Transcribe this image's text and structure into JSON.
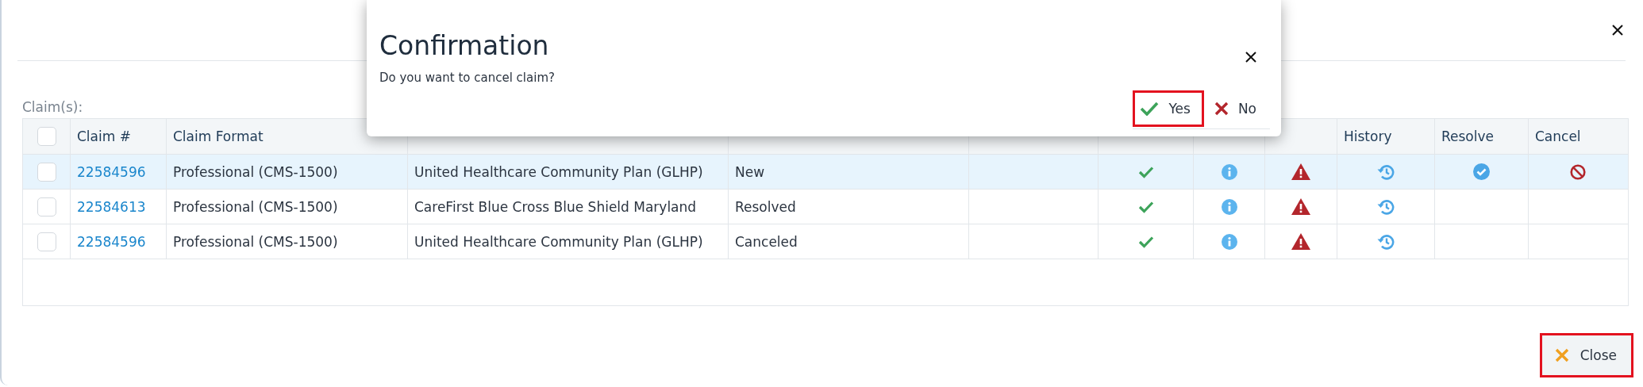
{
  "dialog": {
    "title": "Confirmation",
    "message": "Do you want to cancel claim?",
    "buttons": [
      {
        "label": "Yes",
        "kind": "confirm",
        "focused": true
      },
      {
        "label": "No",
        "kind": "decline",
        "focused": false
      }
    ]
  },
  "section_label": "Claim(s):",
  "table": {
    "select_all": {
      "checked": false
    },
    "columns": [
      {
        "label": "Claim #",
        "kind": "claim"
      },
      {
        "label": "Claim Format",
        "kind": "format"
      },
      {
        "kind": "payer"
      },
      {
        "kind": "status"
      },
      {
        "kind": "sent_date"
      },
      {
        "kind": "sent"
      },
      {
        "kind": "info"
      },
      {
        "kind": "warning"
      },
      {
        "label": "History",
        "kind": "history"
      },
      {
        "label": "Resolve",
        "kind": "resolve"
      },
      {
        "label": "Cancel",
        "kind": "cancel"
      }
    ],
    "rows": [
      {
        "selected": true,
        "checked": false,
        "claim": "22584596",
        "format": "Professional (CMS-1500)",
        "payer": "United Healthcare Community Plan (GLHP)",
        "status": "New",
        "sent": true,
        "info": true,
        "warning": true,
        "history": true,
        "resolve": true,
        "cancel": true
      },
      {
        "selected": false,
        "checked": false,
        "claim": "22584613",
        "format": "Professional (CMS-1500)",
        "payer": "CareFirst Blue Cross Blue Shield Maryland",
        "status": "Resolved",
        "sent": true,
        "info": true,
        "warning": true,
        "history": true,
        "resolve": false,
        "cancel": false
      },
      {
        "selected": false,
        "checked": false,
        "claim": "22584596",
        "format": "Professional (CMS-1500)",
        "payer": "United Healthcare Community Plan (GLHP)",
        "status": "Canceled",
        "sent": true,
        "info": true,
        "warning": true,
        "history": true,
        "resolve": false,
        "cancel": false
      }
    ]
  },
  "footer": {
    "close_button": {
      "label": "Close",
      "focused": true
    }
  }
}
